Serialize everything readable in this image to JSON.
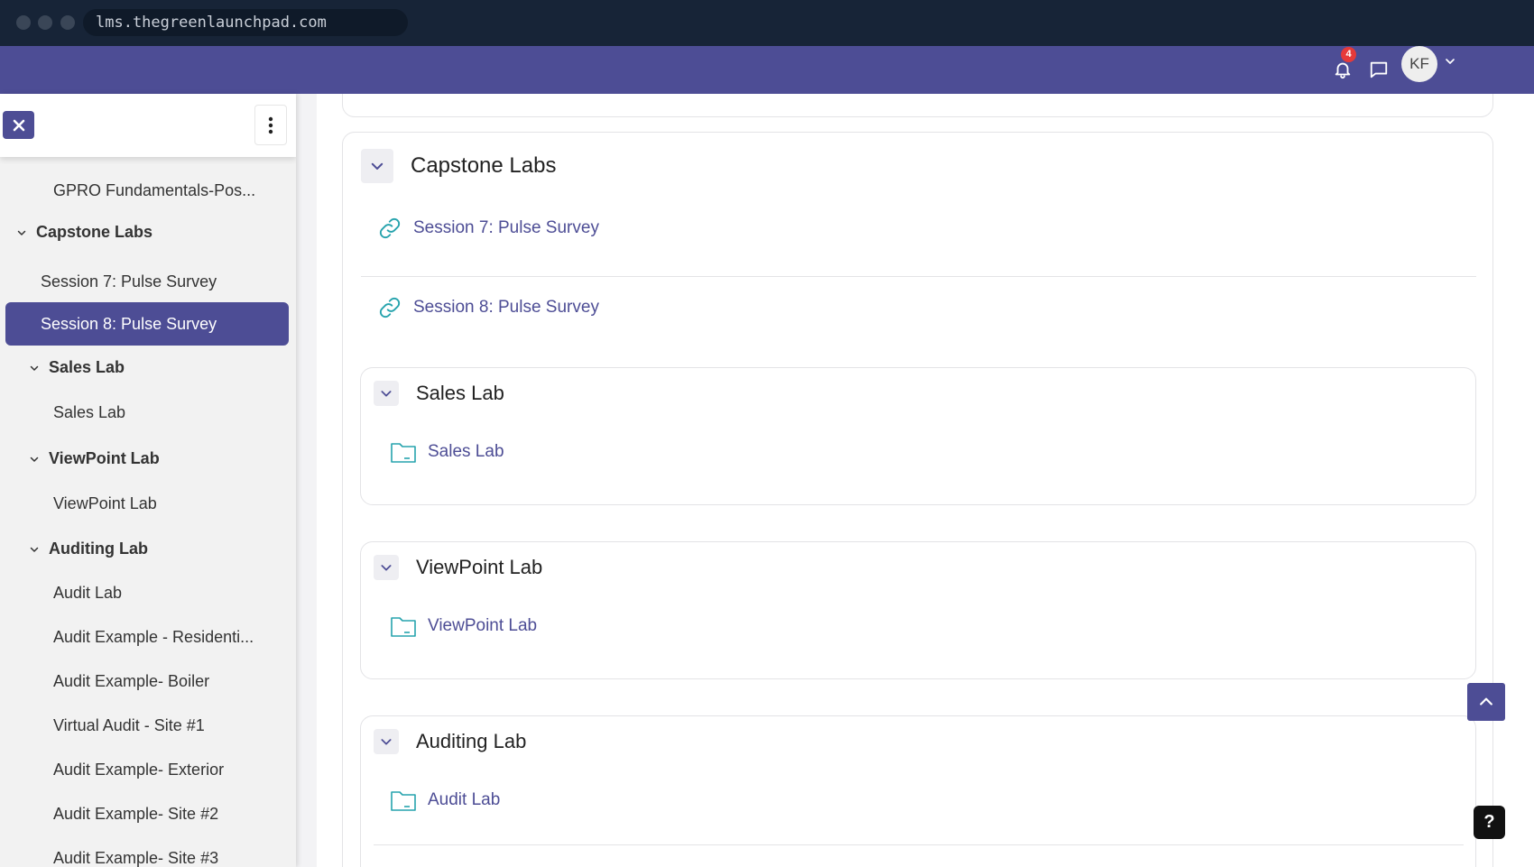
{
  "browser": {
    "url": "lms.thegreenlaunchpad.com"
  },
  "header": {
    "notification_count": "4",
    "avatar_initials": "KF"
  },
  "sidebar": {
    "items": [
      {
        "label": "GPRO Fundamentals-Pos..."
      },
      {
        "label": "Capstone Labs"
      },
      {
        "label": "Session 7: Pulse Survey"
      },
      {
        "label": "Session 8: Pulse Survey"
      },
      {
        "label": "Sales Lab"
      },
      {
        "label": "Sales Lab"
      },
      {
        "label": "ViewPoint Lab"
      },
      {
        "label": "ViewPoint Lab"
      },
      {
        "label": "Auditing Lab"
      },
      {
        "label": "Audit Lab"
      },
      {
        "label": "Audit Example - Residenti..."
      },
      {
        "label": "Audit Example- Boiler"
      },
      {
        "label": "Virtual Audit - Site #1"
      },
      {
        "label": "Audit Example- Exterior"
      },
      {
        "label": "Audit Example- Site #2"
      },
      {
        "label": "Audit Example- Site #3"
      }
    ]
  },
  "main": {
    "capstone": {
      "title": "Capstone Labs",
      "links": [
        {
          "label": "Session 7: Pulse Survey"
        },
        {
          "label": "Session 8: Pulse Survey"
        }
      ]
    },
    "sales": {
      "title": "Sales Lab",
      "link": "Sales Lab"
    },
    "viewpoint": {
      "title": "ViewPoint Lab",
      "link": "ViewPoint Lab"
    },
    "auditing": {
      "title": "Auditing Lab",
      "link": "Audit Lab"
    }
  },
  "help": {
    "label": "?"
  },
  "colors": {
    "brand": "#4d4d95",
    "icon_teal": "#26a3ad",
    "browser_bar": "#172437"
  }
}
